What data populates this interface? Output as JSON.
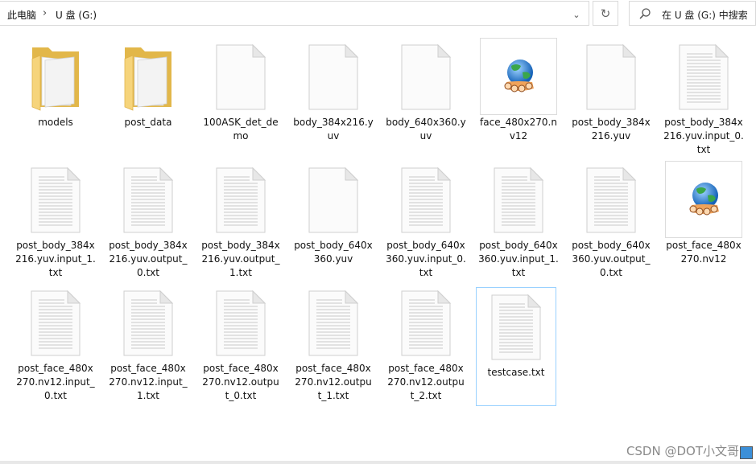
{
  "address_bar": {
    "crumbs": [
      "此电脑",
      "U 盘 (G:)"
    ],
    "separator": "›",
    "dropdown_glyph": "⌄"
  },
  "refresh_glyph": "↻",
  "search": {
    "placeholder": "在 U 盘 (G:) 中搜索"
  },
  "files": [
    {
      "name": "models",
      "icon": "folder-icon"
    },
    {
      "name": "post_data",
      "icon": "folder-icon"
    },
    {
      "name": "100ASK_det_demo",
      "icon": "blank-file-icon"
    },
    {
      "name": "body_384x216.yuv",
      "icon": "blank-file-icon"
    },
    {
      "name": "body_640x360.yuv",
      "icon": "blank-file-icon"
    },
    {
      "name": "face_480x270.nv12",
      "icon": "globe-hand-icon"
    },
    {
      "name": "post_body_384x216.yuv",
      "icon": "blank-file-icon"
    },
    {
      "name": "post_body_384x216.yuv.input_0.txt",
      "icon": "text-file-icon"
    },
    {
      "name": "post_body_384x216.yuv.input_1.txt",
      "icon": "text-file-icon"
    },
    {
      "name": "post_body_384x216.yuv.output_0.txt",
      "icon": "text-file-icon"
    },
    {
      "name": "post_body_384x216.yuv.output_1.txt",
      "icon": "text-file-icon"
    },
    {
      "name": "post_body_640x360.yuv",
      "icon": "blank-file-icon"
    },
    {
      "name": "post_body_640x360.yuv.input_0.txt",
      "icon": "text-file-icon"
    },
    {
      "name": "post_body_640x360.yuv.input_1.txt",
      "icon": "text-file-icon"
    },
    {
      "name": "post_body_640x360.yuv.output_0.txt",
      "icon": "text-file-icon"
    },
    {
      "name": "post_face_480x270.nv12",
      "icon": "globe-hand-icon"
    },
    {
      "name": "post_face_480x270.nv12.input_0.txt",
      "icon": "text-file-icon"
    },
    {
      "name": "post_face_480x270.nv12.input_1.txt",
      "icon": "text-file-icon"
    },
    {
      "name": "post_face_480x270.nv12.output_0.txt",
      "icon": "text-file-icon"
    },
    {
      "name": "post_face_480x270.nv12.output_1.txt",
      "icon": "text-file-icon"
    },
    {
      "name": "post_face_480x270.nv12.output_2.txt",
      "icon": "text-file-icon"
    },
    {
      "name": "testcase.txt",
      "icon": "text-file-icon",
      "selected": true
    }
  ],
  "watermark": "CSDN @DOT小文哥"
}
